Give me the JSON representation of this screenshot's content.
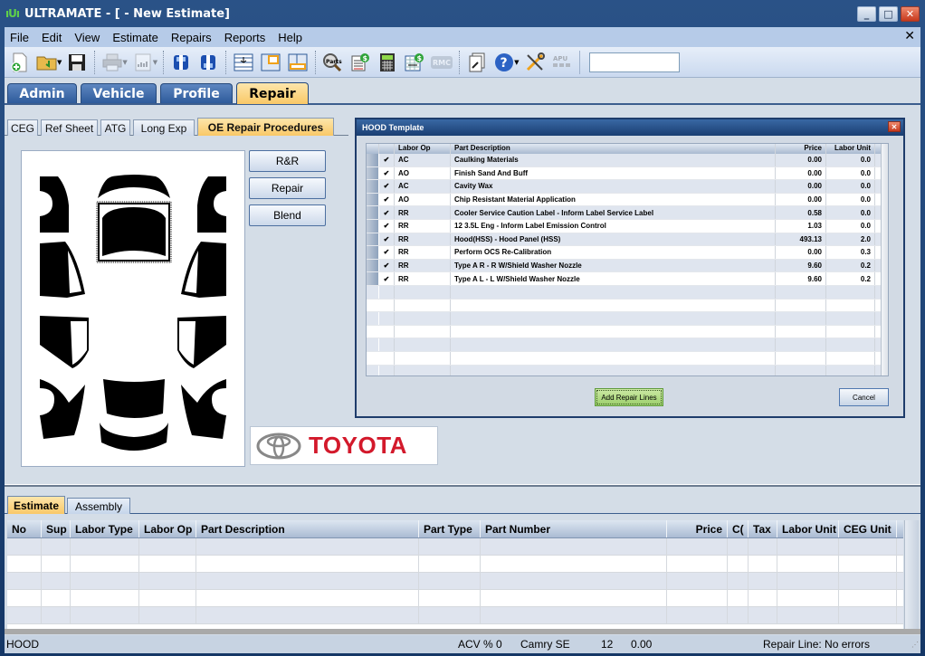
{
  "window": {
    "title": "ULTRAMATE - [ - New Estimate]",
    "logo": "ıUı",
    "minimize": "_",
    "maximize": "□",
    "close": "✕"
  },
  "menu": {
    "items": [
      "File",
      "Edit",
      "View",
      "Estimate",
      "Repairs",
      "Reports",
      "Help"
    ],
    "close_mdi": "✕"
  },
  "toolbar": {
    "buttons": [
      {
        "icon": "new-estimate-icon",
        "glyph": "⊕"
      },
      {
        "icon": "open-folder-icon",
        "glyph": "📂"
      },
      {
        "icon": "save-icon",
        "glyph": "💾"
      },
      {
        "icon": "print-icon",
        "glyph": "🖶",
        "disabled": true
      },
      {
        "icon": "report-icon",
        "glyph": "▤",
        "disabled": true
      },
      {
        "icon": "vehicle-front-icon",
        "glyph": "🚘"
      },
      {
        "icon": "vehicle-rear-icon",
        "glyph": "🚘"
      },
      {
        "icon": "insert-row-icon",
        "glyph": "☰"
      },
      {
        "icon": "layout-top-icon",
        "glyph": "▣"
      },
      {
        "icon": "layout-bottom-icon",
        "glyph": "▣"
      },
      {
        "icon": "parts-search-icon",
        "glyph": "🔍"
      },
      {
        "icon": "price-list-icon",
        "glyph": "$"
      },
      {
        "icon": "calculator-icon",
        "glyph": "▦"
      },
      {
        "icon": "price-transfer-icon",
        "glyph": "$"
      },
      {
        "icon": "rmc-icon",
        "glyph": "RMC",
        "disabled": true
      },
      {
        "icon": "document-tool-icon",
        "glyph": "🗋"
      },
      {
        "icon": "help-icon",
        "glyph": "?"
      },
      {
        "icon": "tools-icon",
        "glyph": "✂"
      },
      {
        "icon": "apu-icon",
        "glyph": "APU",
        "disabled": true
      }
    ],
    "search_value": ""
  },
  "main_tabs": [
    {
      "label": "Admin",
      "active": false
    },
    {
      "label": "Vehicle",
      "active": false
    },
    {
      "label": "Profile",
      "active": false
    },
    {
      "label": "Repair",
      "active": true
    }
  ],
  "sub_tabs": [
    {
      "label": "CEG",
      "active": false
    },
    {
      "label": "Ref Sheet",
      "active": false
    },
    {
      "label": "ATG",
      "active": false
    },
    {
      "label": "Long Exp",
      "active": false
    },
    {
      "label": "OE Repair Procedures",
      "active": true
    }
  ],
  "diagram": {
    "selected_part": "hood"
  },
  "side_buttons": {
    "rr": "R&R",
    "repair": "Repair",
    "blend": "Blend"
  },
  "brand": {
    "name": "TOYOTA",
    "color": "#d3192b"
  },
  "dialog": {
    "title": "HOOD Template",
    "close": "✕",
    "columns": [
      "",
      "",
      "Labor Op",
      "Part Description",
      "Price",
      "Labor Unit"
    ],
    "rows": [
      {
        "checked": "✔",
        "labor_op": "AC",
        "description": "Caulking Materials",
        "price": "0.00",
        "labor_unit": "0.0"
      },
      {
        "checked": "✔",
        "labor_op": "AO",
        "description": "Finish Sand And Buff",
        "price": "0.00",
        "labor_unit": "0.0"
      },
      {
        "checked": "✔",
        "labor_op": "AC",
        "description": "Cavity Wax",
        "price": "0.00",
        "labor_unit": "0.0"
      },
      {
        "checked": "✔",
        "labor_op": "AO",
        "description": "Chip Resistant Material Application",
        "price": "0.00",
        "labor_unit": "0.0"
      },
      {
        "checked": "✔",
        "labor_op": "RR",
        "description": "Cooler Service Caution Label - Inform Label Service Label",
        "price": "0.58",
        "labor_unit": "0.0"
      },
      {
        "checked": "✔",
        "labor_op": "RR",
        "description": "12 3.5L Eng - Inform Label Emission Control",
        "price": "1.03",
        "labor_unit": "0.0"
      },
      {
        "checked": "✔",
        "labor_op": "RR",
        "description": "Hood(HSS) - Hood Panel (HSS)",
        "price": "493.13",
        "labor_unit": "2.0"
      },
      {
        "checked": "✔",
        "labor_op": "RR",
        "description": "Perform OCS Re-Calibration",
        "price": "0.00",
        "labor_unit": "0.3"
      },
      {
        "checked": "✔",
        "labor_op": "RR",
        "description": "Type A R - R W/Shield Washer Nozzle",
        "price": "9.60",
        "labor_unit": "0.2"
      },
      {
        "checked": "✔",
        "labor_op": "RR",
        "description": "Type A L - L W/Shield Washer Nozzle",
        "price": "9.60",
        "labor_unit": "0.2"
      }
    ],
    "add_button": "Add Repair Lines",
    "cancel_button": "Cancel"
  },
  "lower_tabs": [
    {
      "label": "Estimate",
      "active": true
    },
    {
      "label": "Assembly",
      "active": false
    }
  ],
  "estimate_grid": {
    "columns": [
      "No",
      "Sup",
      "Labor Type",
      "Labor Op",
      "Part Description",
      "Part Type",
      "Part Number",
      "Price",
      "C(",
      "Tax",
      "Labor Unit",
      "CEG Unit"
    ],
    "rows": []
  },
  "status_bar": {
    "part": "HOOD",
    "acv": "ACV % 0",
    "vehicle": "Camry SE",
    "year": "12",
    "amount": "0.00",
    "message": "Repair Line: No errors"
  }
}
